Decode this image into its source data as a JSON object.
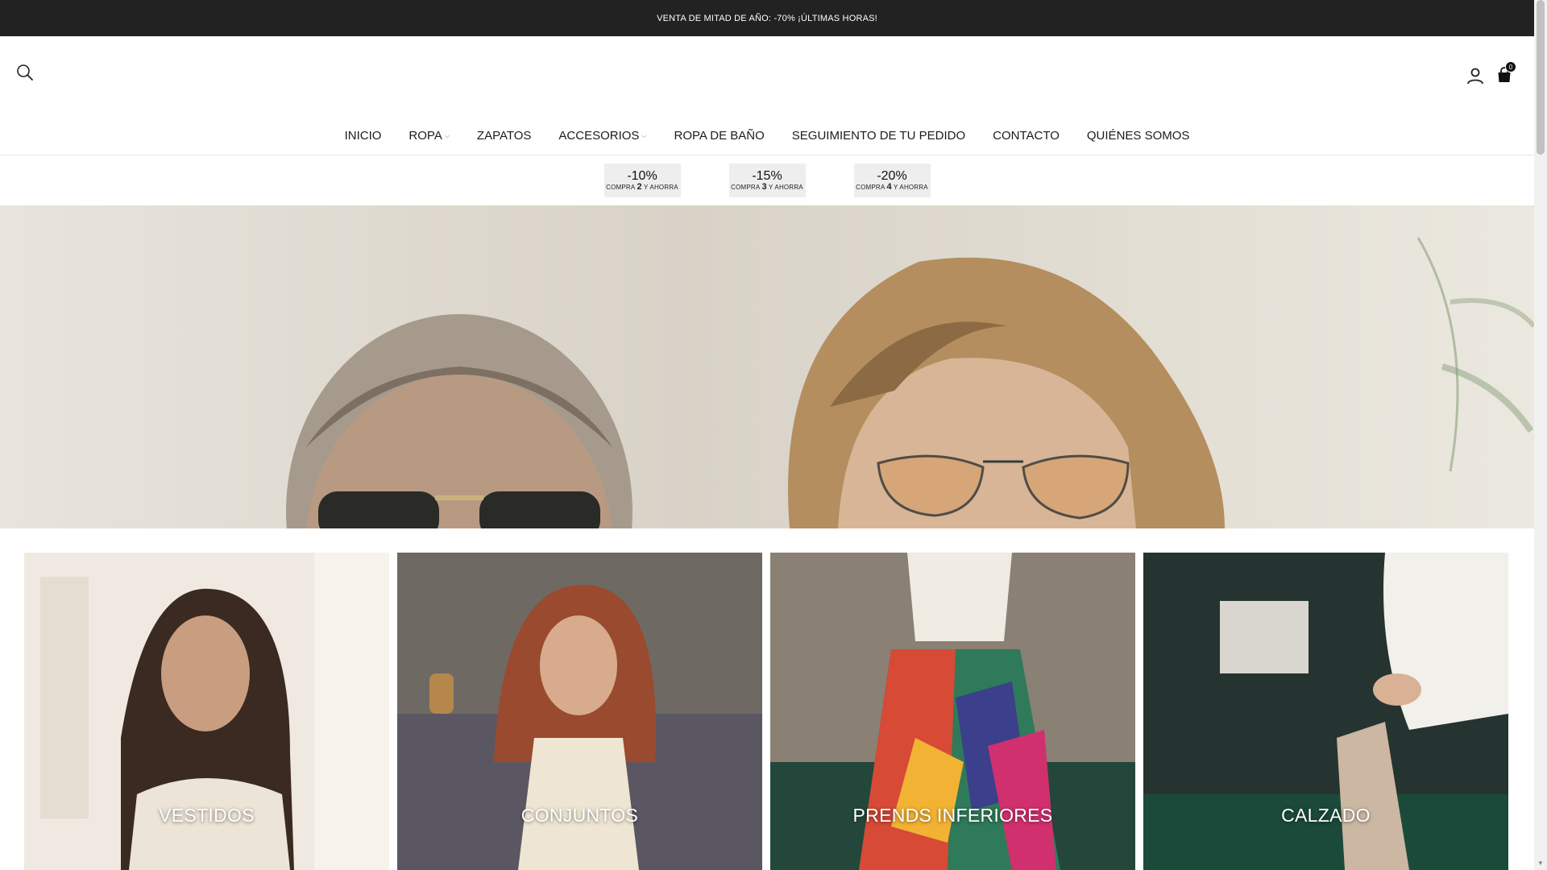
{
  "announcement": {
    "text": "VENTA DE MITAD DE AÑO: -70% ¡ÚLTIMAS HORAS!"
  },
  "header": {
    "icons": {
      "search": "search-icon",
      "account": "user-icon",
      "cart": "shopping-bag-icon"
    },
    "cart_count": "0"
  },
  "nav": {
    "items": [
      {
        "label": "INICIO"
      },
      {
        "label": "ROPA",
        "dropdown": true
      },
      {
        "label": "ZAPATOS"
      },
      {
        "label": "ACCESORIOS",
        "dropdown": true
      },
      {
        "label": "ROPA DE BAÑO"
      },
      {
        "label": "SEGUIMIENTO DE TU PEDIDO"
      },
      {
        "label": "CONTACTO"
      },
      {
        "label": "QUIÉNES SOMOS"
      }
    ]
  },
  "promos": [
    {
      "discount": "-10%",
      "prefix": "COMPRA",
      "qty": "2",
      "suffix": "Y AHORRA"
    },
    {
      "discount": "-15%",
      "prefix": "COMPRA",
      "qty": "3",
      "suffix": "Y AHORRA"
    },
    {
      "discount": "-20%",
      "prefix": "COMPRA",
      "qty": "4",
      "suffix": "Y AHORRA"
    }
  ],
  "categories": [
    {
      "label": "VESTIDOS"
    },
    {
      "label": "CONJUNTOS"
    },
    {
      "label": "PRENDS INFERIORES"
    },
    {
      "label": "CALZADO"
    }
  ],
  "colors": {
    "announcement_bg": "#222222",
    "promo_bg": "#eeeeee",
    "text": "#1c1c1c"
  }
}
